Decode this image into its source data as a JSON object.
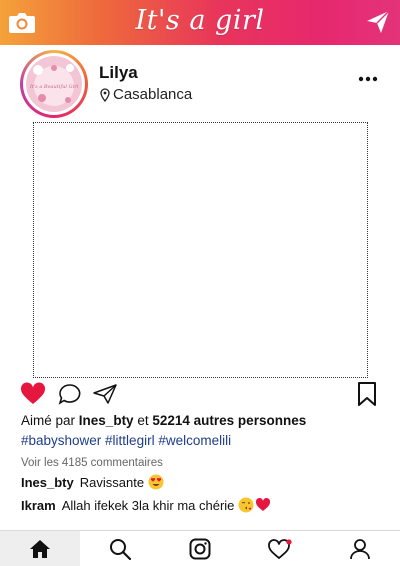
{
  "topbar": {
    "title": "It's a girl",
    "camera_icon": "camera-icon",
    "send_icon": "paper-plane-icon",
    "gradient_colors": [
      "#f4a23a",
      "#e8355b",
      "#e4337a"
    ]
  },
  "profile": {
    "username": "Lilya",
    "location": "Casablanca",
    "avatar_text": "It's a Beautiful Girl"
  },
  "actions": {
    "liked": true,
    "heart_color": "#e5173f"
  },
  "likes": {
    "prefix": "Aimé par",
    "user": "Ines_bty",
    "conjunction": "et",
    "others": "52214 autres personnes"
  },
  "hashtags": "#babyshower #littlegirl #welcomelili",
  "view_comments": "Voir les 4185 commentaires",
  "comments": [
    {
      "user": "Ines_bty",
      "text": "Ravissante",
      "emoji": "heart-eyes-emoji"
    },
    {
      "user": "Ikram",
      "text": "Allah ifekek 3la khir ma chérie",
      "emoji": "kiss-heart-emoji"
    }
  ],
  "bottom_nav": {
    "items": [
      "home-icon",
      "search-icon",
      "instagram-icon",
      "heart-icon",
      "profile-icon"
    ],
    "active": "home-icon",
    "notification_dot_color": "#e5173f"
  }
}
